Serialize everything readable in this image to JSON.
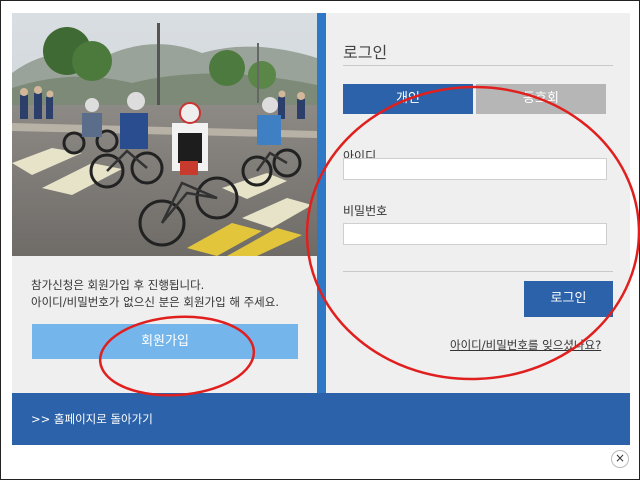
{
  "left": {
    "notice_line1": "참가신청은 회원가입 후 진행됩니다.",
    "notice_line2": "아이디/비밀번호가 없으신 분은 회원가입 해 주세요.",
    "signup_label": "회원가입"
  },
  "login": {
    "title": "로그인",
    "tabs": [
      {
        "label": "개인",
        "active": true
      },
      {
        "label": "동호회",
        "active": false
      }
    ],
    "id_label": "아이디",
    "id_value": "",
    "pw_label": "비밀번호",
    "pw_value": "",
    "submit_label": "로그인",
    "forgot_link": "아이디/비밀번호를 잊으셨나요?"
  },
  "footer": {
    "home_link": ">> 홈페이지로 돌아가기"
  },
  "close_icon": "close-icon",
  "colors": {
    "primary": "#2b62a9",
    "signup_button": "#74b6ec",
    "divider": "#2f78c6",
    "inactive_tab": "#b6b6b6",
    "annotation": "#e0201e"
  }
}
